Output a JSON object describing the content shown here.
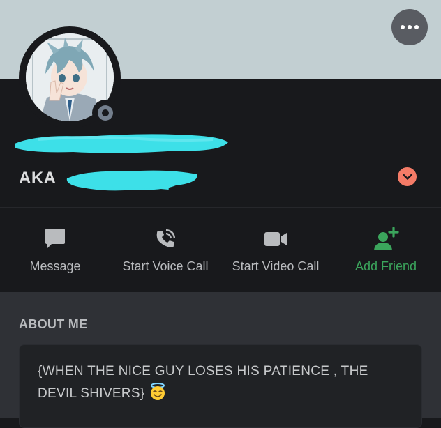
{
  "profile": {
    "aka_label": "AKA",
    "menu_icon": "more-horizontal-icon",
    "status": "offline",
    "colors": {
      "banner": "#c2cfd2",
      "background": "#18191c",
      "redaction": "#3de0e8",
      "chevron": "#f47b67",
      "add_friend": "#3ba55c"
    }
  },
  "actions": [
    {
      "label": "Message",
      "icon": "message-icon"
    },
    {
      "label": "Start Voice Call",
      "icon": "phone-icon"
    },
    {
      "label": "Start Video Call",
      "icon": "video-camera-icon"
    },
    {
      "label": "Add Friend",
      "icon": "add-friend-icon"
    }
  ],
  "about": {
    "title": "ABOUT ME",
    "text": "{WHEN THE NICE GUY LOSES HIS PATIENCE , THE DEVIL SHIVERS}",
    "emoji": "smiling-face-with-halo-emoji"
  }
}
